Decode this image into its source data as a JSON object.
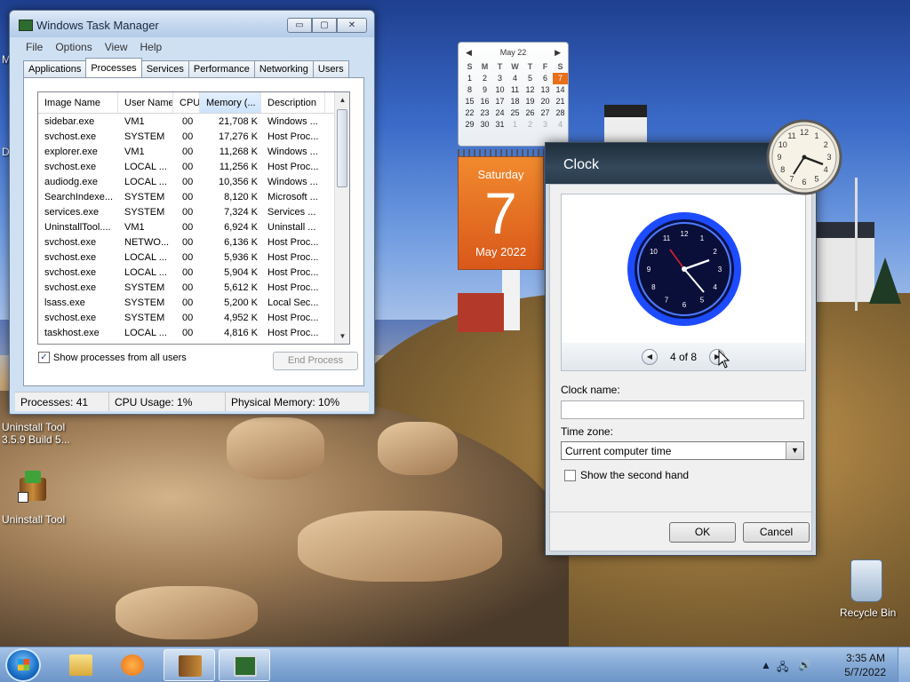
{
  "desktop": {
    "icons": [
      {
        "label_line1": "Uninstall Tool",
        "label_line2": "3.5.9 Build 5..."
      },
      {
        "label": "Uninstall Tool"
      },
      {
        "label": "Recycle Bin"
      }
    ],
    "edge_letters": [
      "M",
      "D"
    ]
  },
  "task_manager": {
    "title": "Windows Task Manager",
    "controls": {
      "minimize": "▭",
      "maximize": "▢",
      "close": "✕"
    },
    "menu": [
      "File",
      "Options",
      "View",
      "Help"
    ],
    "tabs": [
      "Applications",
      "Processes",
      "Services",
      "Performance",
      "Networking",
      "Users"
    ],
    "active_tab": "Processes",
    "columns": [
      "Image Name",
      "User Name",
      "CPU",
      "Memory (...",
      "Description"
    ],
    "rows": [
      [
        "sidebar.exe",
        "VM1",
        "00",
        "21,708 K",
        "Windows ..."
      ],
      [
        "svchost.exe",
        "SYSTEM",
        "00",
        "17,276 K",
        "Host Proc..."
      ],
      [
        "explorer.exe",
        "VM1",
        "00",
        "11,268 K",
        "Windows ..."
      ],
      [
        "svchost.exe",
        "LOCAL ...",
        "00",
        "11,256 K",
        "Host Proc..."
      ],
      [
        "audiodg.exe",
        "LOCAL ...",
        "00",
        "10,356 K",
        "Windows ..."
      ],
      [
        "SearchIndexe...",
        "SYSTEM",
        "00",
        "8,120 K",
        "Microsoft ..."
      ],
      [
        "services.exe",
        "SYSTEM",
        "00",
        "7,324 K",
        "Services ..."
      ],
      [
        "UninstallTool....",
        "VM1",
        "00",
        "6,924 K",
        "Uninstall ..."
      ],
      [
        "svchost.exe",
        "NETWO...",
        "00",
        "6,136 K",
        "Host Proc..."
      ],
      [
        "svchost.exe",
        "LOCAL ...",
        "00",
        "5,936 K",
        "Host Proc..."
      ],
      [
        "svchost.exe",
        "LOCAL ...",
        "00",
        "5,904 K",
        "Host Proc..."
      ],
      [
        "svchost.exe",
        "SYSTEM",
        "00",
        "5,612 K",
        "Host Proc..."
      ],
      [
        "lsass.exe",
        "SYSTEM",
        "00",
        "5,200 K",
        "Local Sec..."
      ],
      [
        "svchost.exe",
        "SYSTEM",
        "00",
        "4,952 K",
        "Host Proc..."
      ],
      [
        "taskhost.exe",
        "LOCAL ...",
        "00",
        "4,816 K",
        "Host Proc..."
      ]
    ],
    "show_all_label": "Show processes from all users",
    "show_all_checked": true,
    "end_process_label": "End Process",
    "status": {
      "processes": "Processes: 41",
      "cpu": "CPU Usage: 1%",
      "memory": "Physical Memory: 10%"
    }
  },
  "calendar": {
    "month_label": "May 22",
    "weekdays": [
      "S",
      "M",
      "T",
      "W",
      "T",
      "F",
      "S"
    ],
    "weeks": [
      [
        "1",
        "2",
        "3",
        "4",
        "5",
        "6",
        "7"
      ],
      [
        "8",
        "9",
        "10",
        "11",
        "12",
        "13",
        "14"
      ],
      [
        "15",
        "16",
        "17",
        "18",
        "19",
        "20",
        "21"
      ],
      [
        "22",
        "23",
        "24",
        "25",
        "26",
        "27",
        "28"
      ],
      [
        "29",
        "30",
        "31",
        "1",
        "2",
        "3",
        "4"
      ]
    ],
    "today_index": 6,
    "day_name": "Saturday",
    "day_number": "7",
    "month_year": "May 2022"
  },
  "clock_dialog": {
    "title": "Clock",
    "page_indicator": "4 of 8",
    "clock_name_label": "Clock name:",
    "clock_name_value": "",
    "time_zone_label": "Time zone:",
    "time_zone_value": "Current computer time",
    "second_hand_label": "Show the second hand",
    "second_hand_checked": false,
    "ok_label": "OK",
    "cancel_label": "Cancel",
    "preview_numerals": [
      "12",
      "1",
      "2",
      "3",
      "4",
      "5",
      "6",
      "7",
      "8",
      "9",
      "10",
      "11"
    ],
    "preview_colors": {
      "ring": "#1d4bff",
      "face": "#0a0f3a",
      "hands": "#ffffff",
      "second": "#e8232a"
    }
  },
  "gadget_clock": {
    "numerals": [
      "12",
      "1",
      "2",
      "3",
      "4",
      "5",
      "6",
      "7",
      "8",
      "9",
      "10",
      "11"
    ]
  },
  "taskbar": {
    "time": "3:35 AM",
    "date": "5/7/2022",
    "tray_icons": [
      "chevron-up-icon",
      "network-icon",
      "speaker-icon"
    ],
    "colors": {
      "accent": "#1f74c9"
    }
  }
}
